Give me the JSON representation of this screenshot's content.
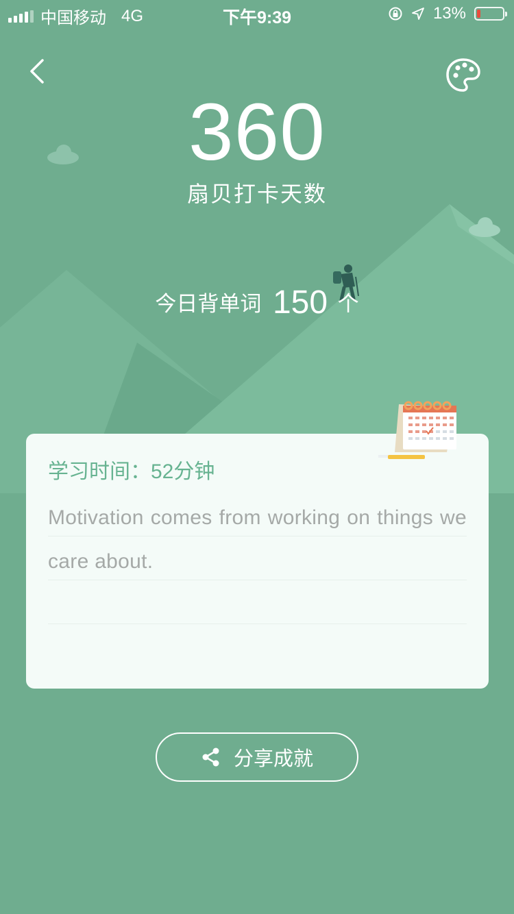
{
  "status_bar": {
    "carrier": "中国移动",
    "network": "4G",
    "time": "下午9:39",
    "battery_percent": "13%",
    "battery_level": 0.13,
    "icons": [
      "signal-icon",
      "orientation-lock-icon",
      "location-arrow-icon",
      "battery-icon"
    ]
  },
  "header": {
    "back_icon": "chevron-left-icon",
    "theme_icon": "palette-icon"
  },
  "streak": {
    "days": "360",
    "label": "扇贝打卡天数"
  },
  "today_words": {
    "prefix": "今日背单词",
    "count": "150",
    "unit": "个"
  },
  "card": {
    "study_time": "学习时间：52分钟",
    "quote": "Motivation comes from working on things we care about."
  },
  "share": {
    "icon": "share-icon",
    "label": "分享成就"
  },
  "colors": {
    "background": "#6fad8f",
    "accent_text": "#67b391",
    "card_bg": "#f4fbf8",
    "battery_low": "#e84c3d"
  }
}
